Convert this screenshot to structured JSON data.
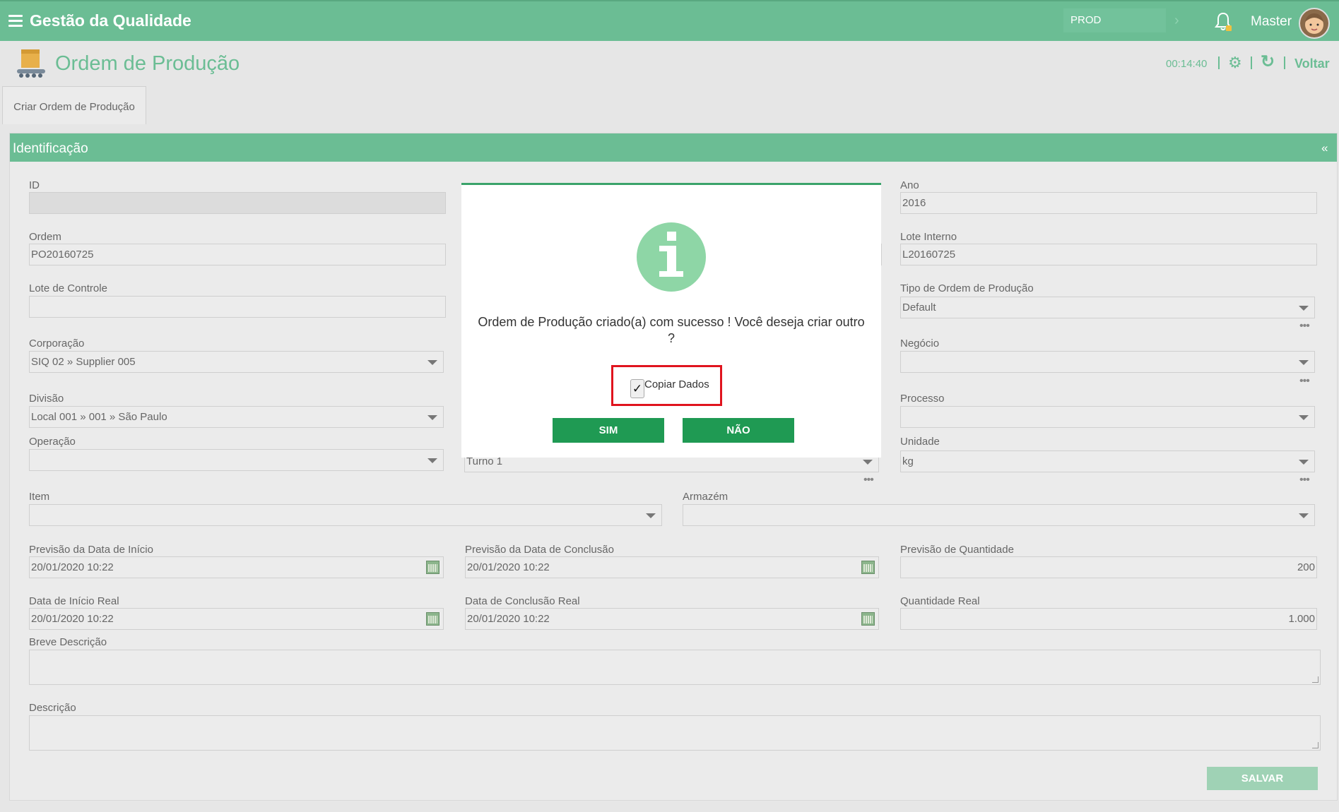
{
  "app": {
    "title": "Gestão da Qualidade",
    "environment": "PROD",
    "user": "Master"
  },
  "page": {
    "title": "Ordem de Produção",
    "timer": "00:14:40",
    "back_label": "Voltar",
    "tab": "Criar Ordem de Produção"
  },
  "section": {
    "title": "Identificação",
    "collapse_glyph": "«"
  },
  "fields": {
    "id": {
      "label": "ID",
      "value": ""
    },
    "ano": {
      "label": "Ano",
      "value": "2016"
    },
    "ordem": {
      "label": "Ordem",
      "value": "PO20160725"
    },
    "lote_interno": {
      "label": "Lote Interno",
      "value": "L20160725"
    },
    "lote_controle": {
      "label": "Lote de Controle",
      "value": ""
    },
    "tipo_ordem": {
      "label": "Tipo de Ordem de Produção",
      "value": "Default"
    },
    "corporacao": {
      "label": "Corporação",
      "value": "SIQ 02 » Supplier 005"
    },
    "negocio": {
      "label": "Negócio",
      "value": ""
    },
    "divisao": {
      "label": "Divisão",
      "value": "Local 001 » 001 » São Paulo"
    },
    "processo": {
      "label": "Processo",
      "value": ""
    },
    "operacao": {
      "label": "Operação",
      "value": ""
    },
    "turno": {
      "value": "Turno 1"
    },
    "unidade": {
      "label": "Unidade",
      "value": "kg"
    },
    "item": {
      "label": "Item",
      "value": ""
    },
    "armazem": {
      "label": "Armazém",
      "value": ""
    },
    "prev_inicio": {
      "label": "Previsão da Data de Início",
      "value": "20/01/2020 10:22"
    },
    "prev_conclusao": {
      "label": "Previsão da Data de Conclusão",
      "value": "20/01/2020 10:22"
    },
    "prev_quantidade": {
      "label": "Previsão de Quantidade",
      "value": "200"
    },
    "inicio_real": {
      "label": "Data de Início Real",
      "value": "20/01/2020 10:22"
    },
    "conclusao_real": {
      "label": "Data de Conclusão Real",
      "value": "20/01/2020 10:22"
    },
    "quantidade_real": {
      "label": "Quantidade Real",
      "value": "1.000"
    },
    "breve_descricao": {
      "label": "Breve Descrição",
      "value": ""
    },
    "descricao": {
      "label": "Descrição",
      "value": ""
    }
  },
  "save_label": "SALVAR",
  "dialog": {
    "message": "Ordem de Produção criado(a) com sucesso ! Você deseja criar outro ?",
    "copy_checked": "✓",
    "copy_label": "Copiar Dados",
    "yes": "SIM",
    "no": "NÃO"
  },
  "colors": {
    "accent": "#6bbd94",
    "dialog_button": "#1f9a53",
    "highlight": "#e0141e"
  },
  "icons": [
    "menu-icon",
    "bell-icon",
    "avatar",
    "production-order-icon",
    "gear-icon",
    "refresh-icon",
    "calendar-icon",
    "info-icon",
    "more-dots-icon"
  ]
}
